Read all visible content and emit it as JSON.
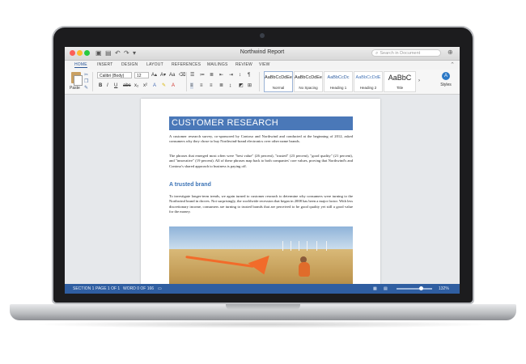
{
  "window": {
    "title": "Northwind Report"
  },
  "search": {
    "placeholder": "Search in Document"
  },
  "tabs": [
    "HOME",
    "INSERT",
    "DESIGN",
    "LAYOUT",
    "REFERENCES",
    "MAILINGS",
    "REVIEW",
    "VIEW"
  ],
  "ribbon": {
    "paste_label": "Paste",
    "font_name": "Calibri (Body)",
    "font_size": "12",
    "styles": [
      {
        "preview": "AaBbCcDdEe",
        "name": "Normal"
      },
      {
        "preview": "AaBbCcDdEe",
        "name": "No Spacing"
      },
      {
        "preview": "AaBbCcDc",
        "name": "Heading 1"
      },
      {
        "preview": "AaBbCcDdE",
        "name": "Heading 2"
      },
      {
        "preview": "AaBbC",
        "name": "Title"
      }
    ],
    "styles_pane_label": "Styles"
  },
  "document": {
    "heading": "CUSTOMER RESEARCH",
    "para1": "A customer research survey, co-sponsored by Contoso and Northwind and conducted at the beginning of 2012, asked consumers why they chose to buy Northwind-brand electronics over other name brands.",
    "para2": "The phrases that emerged most often were \"best value\" (26 percent), \"trusted\" (23 percent), \"good quality\" (21 percent), and \"innovative\" (19 percent). All of these phrases map back to both companies' core values, proving that Northwind's and Contoso's shared approach to business is paying off.",
    "subheading": "A trusted brand",
    "para3": "To investigate longer-term trends, we again turned to customer research to determine why consumers were turning to the Northwind brand in droves. Not surprisingly, the worldwide recession that began in 2008 has been a major factor. With less discretionary income, consumers are turning to trusted brands that are perceived to be good quality yet still a good value for the money."
  },
  "status": {
    "section": "SECTION 1",
    "page": "PAGE 1 OF 1",
    "words": "WORD 0 OF 166",
    "zoom": "132%"
  },
  "colors": {
    "accent": "#2f5ea1",
    "heading_bg": "#4a78b8",
    "subheading": "#3d74b6"
  }
}
